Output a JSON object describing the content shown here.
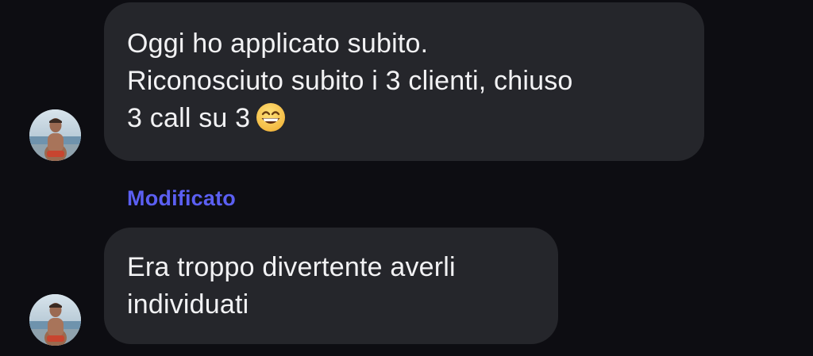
{
  "messages": [
    {
      "lines": [
        "Oggi ho applicato subito.",
        "Riconosciuto subito i 3 clienti, chiuso",
        "3 call su 3"
      ],
      "emoji": "grinning-face-with-smiling-eyes-emoji"
    },
    {
      "lines": [
        "Era troppo divertente averli",
        "individuati"
      ]
    }
  ],
  "edited_label": "Modificato",
  "avatar_icon": "user-avatar-photo",
  "colors": {
    "background": "#0d0d12",
    "bubble": "#25262b",
    "text": "#f2f2f4",
    "edited_label": "#5b5ff2"
  }
}
